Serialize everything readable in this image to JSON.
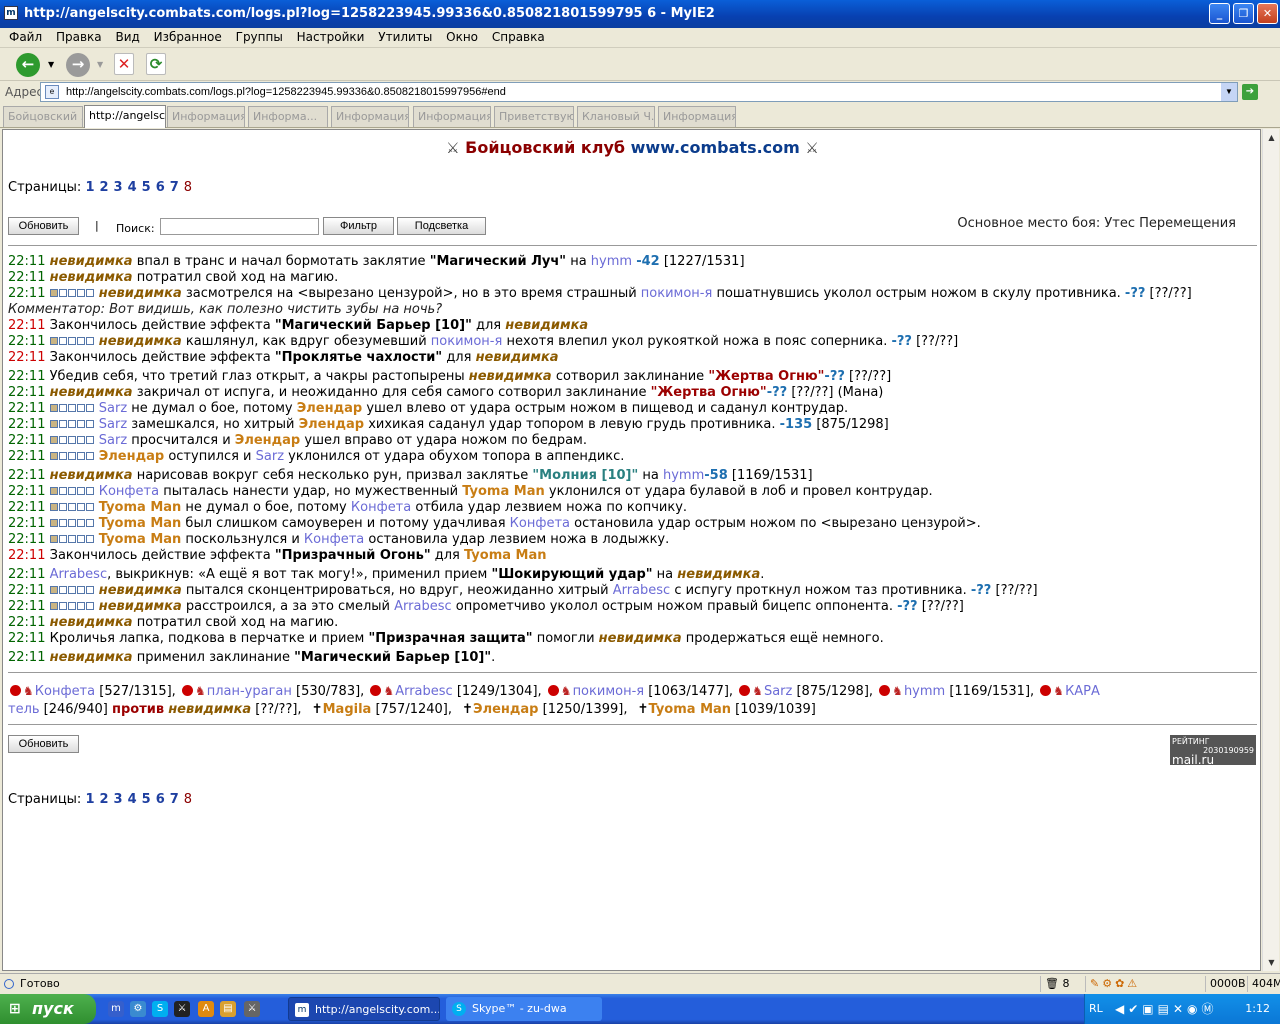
{
  "window": {
    "title": "http://angelscity.combats.com/logs.pl?log=1258223945.99336&0.850821801599795 6 - MyIE2",
    "buttons": [
      "_",
      "❐",
      "✕"
    ]
  },
  "menu": [
    "Файл",
    "Правка",
    "Вид",
    "Избранное",
    "Группы",
    "Настройки",
    "Утилиты",
    "Окно",
    "Справка"
  ],
  "address": {
    "label": "Адрес",
    "url": "http://angelscity.combats.com/logs.pl?log=1258223945.99336&0.8508218015997956#end"
  },
  "tabs": [
    "Бойцовский ...",
    "http://angelsc...",
    "Информация...",
    "Информа...",
    "Информация...",
    "Информация...",
    "Приветствую...",
    "Клановый Ч...",
    "Информация..."
  ],
  "page": {
    "header": {
      "part1": "Бойцовский клуб",
      "part2": "www.combats.com"
    },
    "pages_label": "Страницы:",
    "pages": [
      "1",
      "2",
      "3",
      "4",
      "5",
      "6",
      "7",
      "8"
    ],
    "refresh_label": "Обновить",
    "separator": "|",
    "search_label": "Поиск:",
    "filter_label": "Фильтр",
    "highlight_label": "Подсветка",
    "place": "Основное место боя: Утес Перемещения",
    "rating": {
      "l1": "РЕЙТИНГ",
      "n1": "2030190959",
      "l2": "mail.ru",
      "n2": "20238545",
      "n3": "52878"
    }
  },
  "log": [
    {
      "time": "22:11",
      "parts": [
        [
          "p1",
          "невидимка"
        ],
        [
          "",
          " впал в транс и начал бормотать заклятие "
        ],
        [
          "sp",
          "\"Магический Луч\""
        ],
        [
          "",
          " на "
        ],
        [
          "p2",
          "hymm"
        ],
        [
          "",
          " "
        ],
        [
          "dmg",
          "-42"
        ],
        [
          "",
          " [1227/1531]"
        ]
      ]
    },
    {
      "time": "22:11",
      "parts": [
        [
          "p1",
          "невидимка"
        ],
        [
          "",
          " потратил свой ход на магию."
        ]
      ]
    },
    {
      "time": "22:11",
      "sq": "1",
      "parts": [
        [
          "p1",
          "невидимка"
        ],
        [
          "",
          " засмотрелся на <вырезано цензурой>, но в это время страшный "
        ],
        [
          "p2",
          "покимон-я"
        ],
        [
          "",
          " пошатнувшись уколол острым ножом в скулу противника. "
        ],
        [
          "dmg",
          "-??"
        ],
        [
          "",
          " [??/??]"
        ]
      ]
    },
    {
      "time": "",
      "parts": [
        [
          "cm",
          "Комментатор: Вот видишь, как полезно чистить зубы на ночь?"
        ]
      ]
    },
    {
      "time": "22:11",
      "tr": "1",
      "parts": [
        [
          "",
          " Закончилось действие эффекта "
        ],
        [
          "sp",
          "\"Магический Барьер [10]\""
        ],
        [
          "",
          " для "
        ],
        [
          "p1",
          "невидимка"
        ]
      ]
    },
    {
      "time": "22:11",
      "sq": "1",
      "parts": [
        [
          "p1",
          "невидимка"
        ],
        [
          "",
          " кашлянул, как вдруг обезумевший "
        ],
        [
          "p2",
          "покимон-я"
        ],
        [
          "",
          " нехотя влепил укол рукояткой ножа в пояс соперника. "
        ],
        [
          "dmg",
          "-??"
        ],
        [
          "",
          " [??/??]"
        ]
      ]
    },
    {
      "time": "22:11",
      "tr": "1",
      "parts": [
        [
          "",
          " Закончилось действие эффекта "
        ],
        [
          "sp",
          "\"Проклятье чахлости\""
        ],
        [
          "",
          " для "
        ],
        [
          "p1",
          "невидимка"
        ]
      ]
    },
    {
      "time": "22:11",
      "parts": [
        [
          "",
          "Убедив себя, что третий глаз открыт, а чакры растопырены "
        ],
        [
          "p1",
          "невидимка"
        ],
        [
          "",
          " сотворил заклинание "
        ],
        [
          "sr",
          "\"Жертва Огню\""
        ],
        [
          ". "
        ],
        [
          "dmg",
          "-??"
        ],
        [
          "",
          " [??/??]"
        ]
      ]
    },
    {
      "time": "22:11",
      "parts": [
        [
          "p1",
          "невидимка"
        ],
        [
          "",
          " закричал от испуга, и неожиданно для себя самого сотворил заклинание "
        ],
        [
          "sr",
          "\"Жертва Огню\""
        ],
        [
          ". "
        ],
        [
          "dmg",
          "-??"
        ],
        [
          "",
          " [??/??] (Мана)"
        ]
      ]
    },
    {
      "time": "22:11",
      "sq": "1",
      "parts": [
        [
          "p2",
          "Sarz"
        ],
        [
          "",
          " не думал о бое, потому "
        ],
        [
          "p3",
          "Элендар"
        ],
        [
          "",
          " ушел влево от удара острым ножом в пищевод и саданул контрудар."
        ]
      ]
    },
    {
      "time": "22:11",
      "sq": "1",
      "parts": [
        [
          "p2",
          "Sarz"
        ],
        [
          "",
          " замешкался, но хитрый "
        ],
        [
          "p3",
          "Элендар"
        ],
        [
          "",
          " хихикая саданул удар топором в левую грудь противника. "
        ],
        [
          "dmg",
          "-135"
        ],
        [
          "",
          " [875/1298]"
        ]
      ]
    },
    {
      "time": "22:11",
      "sq": "1",
      "parts": [
        [
          "p2",
          "Sarz"
        ],
        [
          "",
          " просчитался и "
        ],
        [
          "p3",
          "Элендар"
        ],
        [
          "",
          " ушел вправо от удара ножом по бедрам."
        ]
      ]
    },
    {
      "time": "22:11",
      "sq": "1",
      "parts": [
        [
          "p3",
          "Элендар"
        ],
        [
          "",
          " оступился и "
        ],
        [
          "p2",
          "Sarz"
        ],
        [
          "",
          " уклонился от удара обухом топора в аппендикс."
        ]
      ]
    },
    {
      "time": "22:11",
      "parts": [
        [
          "p1",
          "невидимка"
        ],
        [
          "",
          " нарисовав вокруг себя несколько рун, призвал заклятье "
        ],
        [
          "sg",
          "\"Молния [10]\""
        ],
        [
          "",
          " на "
        ],
        [
          "p2",
          "hymm"
        ],
        [
          ". "
        ],
        [
          "dmg",
          "-58"
        ],
        [
          "",
          " [1169/1531]"
        ]
      ]
    },
    {
      "time": "22:11",
      "sq": "1",
      "parts": [
        [
          "p2",
          "Конфета"
        ],
        [
          "",
          " пыталась нанести удар, но мужественный "
        ],
        [
          "p3",
          "Tyoma Man"
        ],
        [
          "",
          " уклонился от удара булавой в лоб и провел контрудар."
        ]
      ]
    },
    {
      "time": "22:11",
      "sq": "1",
      "parts": [
        [
          "p3",
          "Tyoma Man"
        ],
        [
          "",
          " не думал о бое, потому "
        ],
        [
          "p2",
          "Конфета"
        ],
        [
          "",
          " отбила удар лезвием ножа по копчику."
        ]
      ]
    },
    {
      "time": "22:11",
      "sq": "1",
      "parts": [
        [
          "p3",
          "Tyoma Man"
        ],
        [
          "",
          " был слишком самоуверен и потому удачливая "
        ],
        [
          "p2",
          "Конфета"
        ],
        [
          "",
          " остановила удар острым ножом по <вырезано цензурой>."
        ]
      ]
    },
    {
      "time": "22:11",
      "sq": "1",
      "parts": [
        [
          "p3",
          "Tyoma Man"
        ],
        [
          "",
          " поскользнулся и "
        ],
        [
          "p2",
          "Конфета"
        ],
        [
          "",
          " остановила удар лезвием ножа в лодыжку."
        ]
      ]
    },
    {
      "time": "22:11",
      "tr": "1",
      "parts": [
        [
          "",
          " Закончилось действие эффекта "
        ],
        [
          "sp",
          "\"Призрачный Огонь\""
        ],
        [
          "",
          " для "
        ],
        [
          "p3",
          "Tyoma Man"
        ]
      ]
    },
    {
      "time": "22:11",
      "parts": [
        [
          "p2",
          "Arrabesc"
        ],
        [
          "",
          ", выкрикнув: «А ещё я вот так могу!», применил прием "
        ],
        [
          "sp",
          "\"Шокирующий удар\""
        ],
        [
          "",
          " на "
        ],
        [
          "p1",
          "невидимка"
        ],
        [
          "",
          "."
        ]
      ]
    },
    {
      "time": "22:11",
      "sq": "1",
      "parts": [
        [
          "p1",
          "невидимка"
        ],
        [
          "",
          " пытался сконцентрироваться, но вдруг, неожиданно хитрый "
        ],
        [
          "p2",
          "Arrabesc"
        ],
        [
          "",
          " с испугу проткнул ножом таз противника. "
        ],
        [
          "dmg",
          "-??"
        ],
        [
          "",
          " [??/??]"
        ]
      ]
    },
    {
      "time": "22:11",
      "sq": "1",
      "parts": [
        [
          "p1",
          "невидимка"
        ],
        [
          "",
          " расстроился, а за это смелый "
        ],
        [
          "p2",
          "Arrabesc"
        ],
        [
          "",
          " опрометчиво уколол острым ножом правый бицепс оппонента. "
        ],
        [
          "dmg",
          "-??"
        ],
        [
          "",
          " [??/??]"
        ]
      ]
    },
    {
      "time": "22:11",
      "parts": [
        [
          "p1",
          "невидимка"
        ],
        [
          "",
          " потратил свой ход на магию."
        ]
      ]
    },
    {
      "time": "22:11",
      "parts": [
        [
          "",
          "Кроличья лапка, подкова в перчатке и прием "
        ],
        [
          "sp",
          "\"Призрачная защита\""
        ],
        [
          "",
          " помогли "
        ],
        [
          "p1",
          "невидимка"
        ],
        [
          "",
          " продержаться ещё немного."
        ]
      ]
    },
    {
      "time": "22:11",
      "parts": [
        [
          "p1",
          "невидимка"
        ],
        [
          "",
          " применил заклинание "
        ],
        [
          "sp",
          "\"Магический Барьер [10]\""
        ],
        [
          "",
          "."
        ]
      ]
    }
  ],
  "teams": {
    "line1": [
      [
        "p2",
        "Конфета"
      ],
      [
        "",
        " [527/1315], "
      ],
      [
        "p2",
        "план-ураган"
      ],
      [
        "",
        " [530/783], "
      ],
      [
        "p2",
        "Arrabesc"
      ],
      [
        "",
        " [1249/1304], "
      ],
      [
        "p2",
        "покимон-я"
      ],
      [
        "",
        " [1063/1477], "
      ],
      [
        "p2",
        "Sarz"
      ],
      [
        "",
        " [875/1298], "
      ],
      [
        "p2",
        "hymm"
      ],
      [
        "",
        " [1169/1531], "
      ],
      [
        "p2",
        "КАРА"
      ]
    ],
    "line2": [
      [
        "p2",
        "тель"
      ],
      [
        "",
        " [246/940] "
      ],
      [
        "sr",
        "против"
      ],
      [
        "",
        " "
      ],
      [
        "p1",
        "невидимка"
      ],
      [
        "",
        " [??/??], "
      ],
      [
        "p3",
        "Magila"
      ],
      [
        "",
        " [757/1240], "
      ],
      [
        "p3",
        "Элендар"
      ],
      [
        "",
        " [1250/1399], "
      ],
      [
        "p3",
        "Tyoma Man"
      ],
      [
        "",
        " [1039/1039]"
      ]
    ]
  },
  "status": {
    "text": "Готово",
    "count": "8",
    "bytes": "0000B",
    "mem": "404M"
  },
  "taskbar": {
    "start": "пуск",
    "tasks": [
      "http://angelscity.com...",
      "Skype™ - zu-dwa"
    ],
    "lang": "RL",
    "clock": "1:12"
  }
}
